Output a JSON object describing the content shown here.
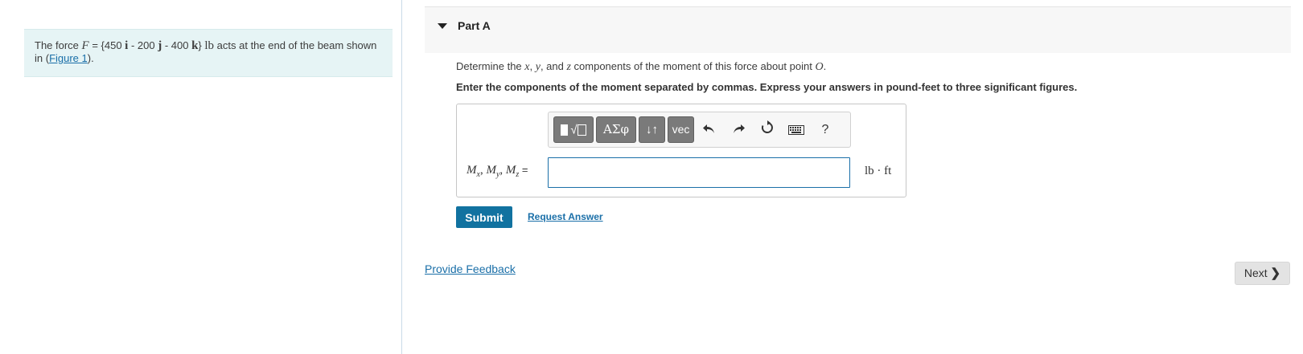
{
  "problem": {
    "text_before": "The force ",
    "force_symbol": "F",
    "eq_open": " = {450 ",
    "unit_i": "i",
    "mid1": " - 200 ",
    "unit_j": "j",
    "mid2": " - 400 ",
    "unit_k": "k",
    "close": "} ",
    "force_unit": "lb",
    "text_after": " acts at the end of the beam shown in (",
    "figure_link": "Figure 1",
    "text_end": ")."
  },
  "part": {
    "title": "Part A",
    "collapse_icon": "triangle-down-icon"
  },
  "question": {
    "q1_before": "Determine the ",
    "x": "x",
    "comma1": ", ",
    "y": "y",
    "and": ", and ",
    "z": "z",
    "q1_mid": " components of the moment of this force about point ",
    "point": "O",
    "q1_end": ".",
    "instruction": "Enter the components of the moment separated by commas. Express your answers in pound-feet to three significant figures."
  },
  "toolbar": {
    "symbols_label": "ΑΣφ",
    "arrows_label": "↓↑",
    "vec_label": "vec",
    "help_label": "?",
    "icons": [
      "templates-icon",
      "undo-icon",
      "redo-icon",
      "reset-icon",
      "keyboard-icon",
      "help-icon"
    ]
  },
  "answer": {
    "label_m": "M",
    "sub_x": "x",
    "sub_y": "y",
    "sub_z": "z",
    "sep": ", ",
    "equals": " =",
    "value": "",
    "units": "lb · ft"
  },
  "actions": {
    "submit_label": "Submit",
    "request_label": "Request Answer",
    "feedback_label": "Provide Feedback",
    "next_label": "Next ",
    "next_chevron": "❯"
  },
  "colors": {
    "accent": "#1172a0",
    "link": "#1a6fa8",
    "problem_bg": "#e6f4f5",
    "header_bg": "#f7f7f7"
  }
}
